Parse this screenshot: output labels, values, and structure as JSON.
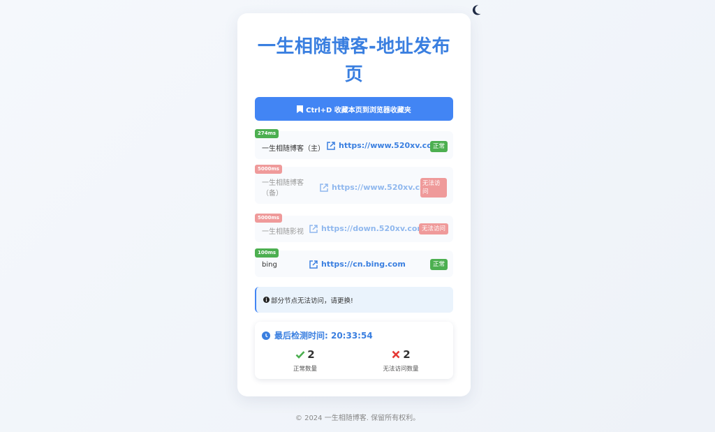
{
  "page": {
    "title": "一生相随博客-地址发布页"
  },
  "bookmark": {
    "label": "Ctrl+D 收藏本页到浏览器收藏夹"
  },
  "sites": [
    {
      "name": "一生相随博客（主）",
      "url": "https://www.520xv.com",
      "latency": "274ms",
      "status": "正常"
    },
    {
      "name": "一生相随博客（备）",
      "url": "https://www.520xv.com",
      "latency": "5000ms",
      "status": "无法访问"
    },
    {
      "name": "一生相随影视",
      "url": "https://down.520xv.com",
      "latency": "5000ms",
      "status": "无法访问"
    },
    {
      "name": "bing",
      "url": "https://cn.bing.com",
      "latency": "100ms",
      "status": "正常"
    }
  ],
  "alert": {
    "text": "部分节点无法访问，请更换!"
  },
  "stats": {
    "last_check_label": "最后检测时间: 20:33:54",
    "ok_count": "2",
    "ok_label": "正常数量",
    "fail_count": "2",
    "fail_label": "无法访问数量"
  },
  "footer": {
    "text": "© 2024 一生相随博客. 保留所有权利。"
  },
  "colors": {
    "accent": "#4285f4",
    "ok": "#4caf50",
    "bad": "#ef9a9a",
    "fail_icon": "#e53935"
  },
  "icons": [
    "moon-icon",
    "bookmark-icon",
    "external-link-icon",
    "info-icon",
    "clock-icon",
    "check-icon",
    "cross-icon"
  ]
}
